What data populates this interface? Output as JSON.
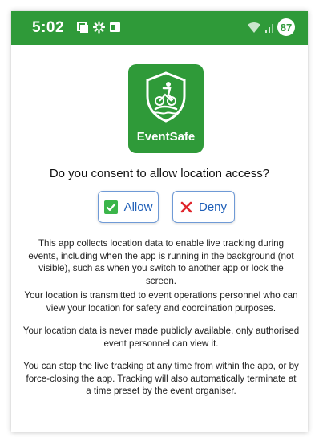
{
  "status_bar": {
    "time": "5:02",
    "battery": "87",
    "notification_icons": [
      "image-notification-icon",
      "gear-notification-icon",
      "card-notification-icon"
    ],
    "right_icons": [
      "wifi-icon",
      "signal-icon"
    ],
    "color": "#2f9a39"
  },
  "logo": {
    "name": "EventSafe",
    "icon": "shield-triathlete-icon",
    "color": "#2f9a39"
  },
  "consent": {
    "question": "Do you consent to allow location access?",
    "allow_label": "Allow",
    "deny_label": "Deny",
    "allow_icon": "check-icon",
    "deny_icon": "x-icon"
  },
  "paragraphs": [
    "This app collects location data to enable live tracking during events, including when the app is running in the background (not visible), such as when you switch to another app or lock the screen.",
    "Your location is transmitted to event operations personnel who can view your location for safety and coordination purposes.",
    "Your location data is never made publicly available, only authorised event personnel can view it.",
    "You can stop the live tracking at any time from within the app, or by force-closing the app. Tracking will also automatically terminate at a time preset by the event organiser."
  ]
}
